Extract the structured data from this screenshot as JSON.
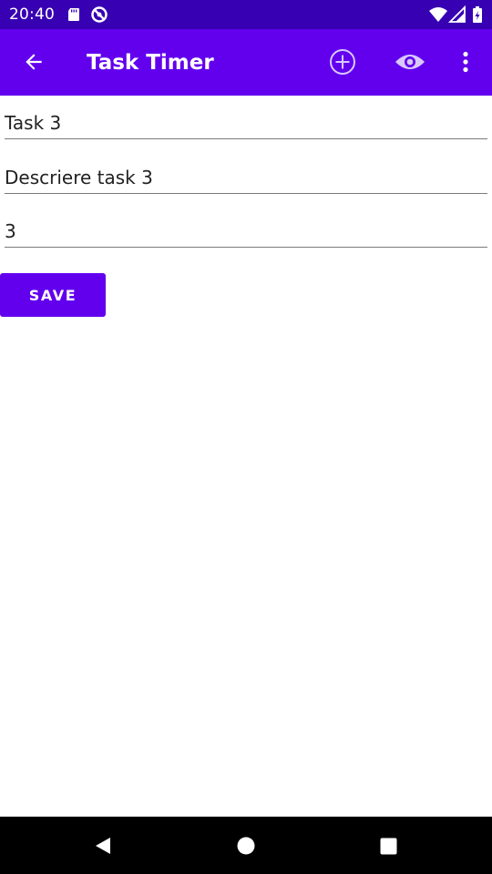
{
  "status_bar": {
    "time": "20:40",
    "left_icons": [
      "sd-card-icon",
      "no-disturb-icon"
    ],
    "right_icons": [
      "wifi-icon",
      "signal-icon",
      "battery-icon"
    ]
  },
  "app_bar": {
    "title": "Task Timer",
    "background": "#6200EE",
    "navigation_icon": "back-arrow-icon",
    "actions": [
      "add-circle-icon",
      "eye-icon",
      "overflow-menu-icon"
    ]
  },
  "form": {
    "name_value": "Task 3",
    "description_value": "Descriere task 3",
    "sort_order_value": "3",
    "save_label": "SAVE"
  },
  "nav_bar": {
    "buttons": [
      "back-triangle-icon",
      "home-circle-icon",
      "recents-square-icon"
    ]
  },
  "colors": {
    "status_bar": "#3700B3",
    "primary": "#6200EE",
    "underline": "#7a7a7a"
  }
}
